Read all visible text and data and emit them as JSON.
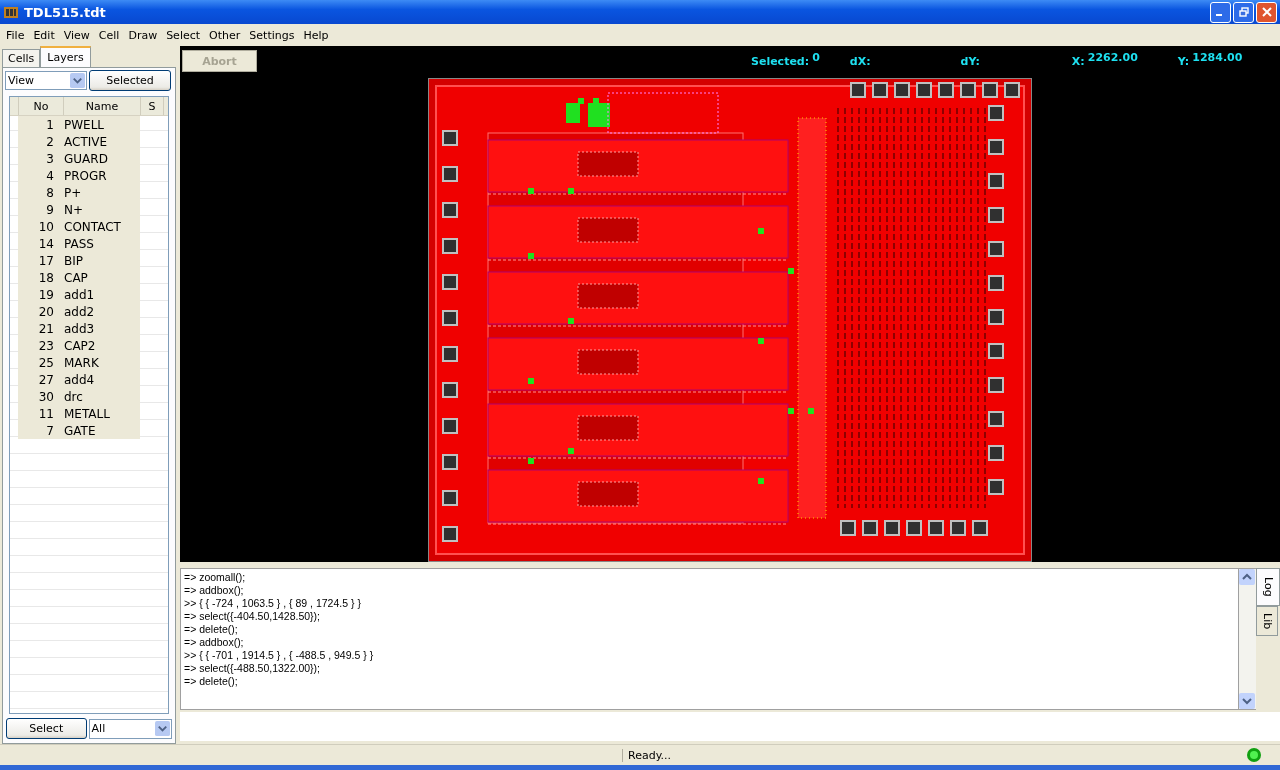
{
  "window": {
    "title": "TDL515.tdt"
  },
  "menu": [
    "File",
    "Edit",
    "View",
    "Cell",
    "Draw",
    "Select",
    "Other",
    "Settings",
    "Help"
  ],
  "tabs": [
    {
      "label": "Cells",
      "selected": false
    },
    {
      "label": "Layers",
      "selected": true
    }
  ],
  "view_select": {
    "value": "View"
  },
  "selected_button": "Selected",
  "layers_table": {
    "columns": [
      "No",
      "Name",
      "S"
    ],
    "rows": [
      {
        "no": "1",
        "name": "PWELL"
      },
      {
        "no": "2",
        "name": "ACTIVE"
      },
      {
        "no": "3",
        "name": "GUARD"
      },
      {
        "no": "4",
        "name": "PROGR"
      },
      {
        "no": "8",
        "name": "P+"
      },
      {
        "no": "9",
        "name": "N+"
      },
      {
        "no": "10",
        "name": "CONTACT"
      },
      {
        "no": "14",
        "name": "PASS"
      },
      {
        "no": "17",
        "name": "BIP"
      },
      {
        "no": "18",
        "name": "CAP"
      },
      {
        "no": "19",
        "name": "add1"
      },
      {
        "no": "20",
        "name": "add2"
      },
      {
        "no": "21",
        "name": "add3"
      },
      {
        "no": "23",
        "name": "CAP2"
      },
      {
        "no": "25",
        "name": "MARK"
      },
      {
        "no": "27",
        "name": "add4"
      },
      {
        "no": "30",
        "name": "drc"
      },
      {
        "no": "11",
        "name": "METALL"
      },
      {
        "no": "7",
        "name": "GATE"
      }
    ]
  },
  "select_button": "Select",
  "filter_select": {
    "value": "All"
  },
  "toolbar": {
    "abort_button": {
      "label": "Abort",
      "disabled": true
    },
    "selected_label": "Selected:",
    "selected_value": "0",
    "dx_label": "dX:",
    "dy_label": "dY:",
    "x_label": "X:",
    "x_value": "2262.00",
    "y_label": "Y:",
    "y_value": "1284.00"
  },
  "console": {
    "lines": [
      "=> zoomall();",
      "=> addbox();",
      ">> { { -724 , 1063.5 } , { 89 , 1724.5 } }",
      "=> select({-404.50,1428.50});",
      "=> delete();",
      "=> addbox();",
      ">> { { -701 , 1914.5 } , { -488.5 , 949.5 } }",
      "=> select({-488.50,1322.00});",
      "=> delete();"
    ]
  },
  "side_tabs": [
    {
      "label": "Log",
      "selected": true
    },
    {
      "label": "Lib",
      "selected": false
    }
  ],
  "status_bar": {
    "text": "Ready..."
  }
}
